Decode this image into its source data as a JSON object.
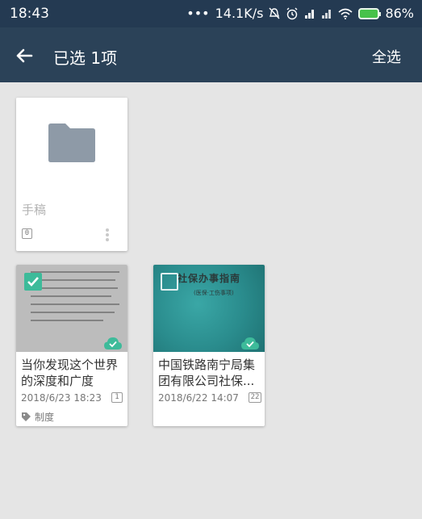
{
  "status_bar": {
    "time": "18:43",
    "dots": "•••",
    "speed": "14.1K/s",
    "battery": "86%",
    "battery_color": "#47c24a"
  },
  "app_bar": {
    "title": "已选 1项",
    "select_all": "全选",
    "back_icon": "arrow-left-icon"
  },
  "folder": {
    "name": "手稿",
    "count": "0",
    "icon": "folder-icon"
  },
  "documents": [
    {
      "title": "当你发现这个世界的深度和广度",
      "date": "2018/6/23 18:23",
      "page_count": "1",
      "tag": "制度",
      "selected": true,
      "synced": true
    },
    {
      "title": "中国铁路南宁局集团有限公司社保...",
      "date": "2018/6/22 14:07",
      "page_count": "22",
      "selected": false,
      "synced": true,
      "thumb_title": "社保办事指南",
      "thumb_subtitle": "(医保·工伤事项)"
    }
  ],
  "colors": {
    "app_bar": "#2b4258",
    "status_bar": "#243a52",
    "accent": "#3dbb9a",
    "background": "#e5e5e5"
  }
}
